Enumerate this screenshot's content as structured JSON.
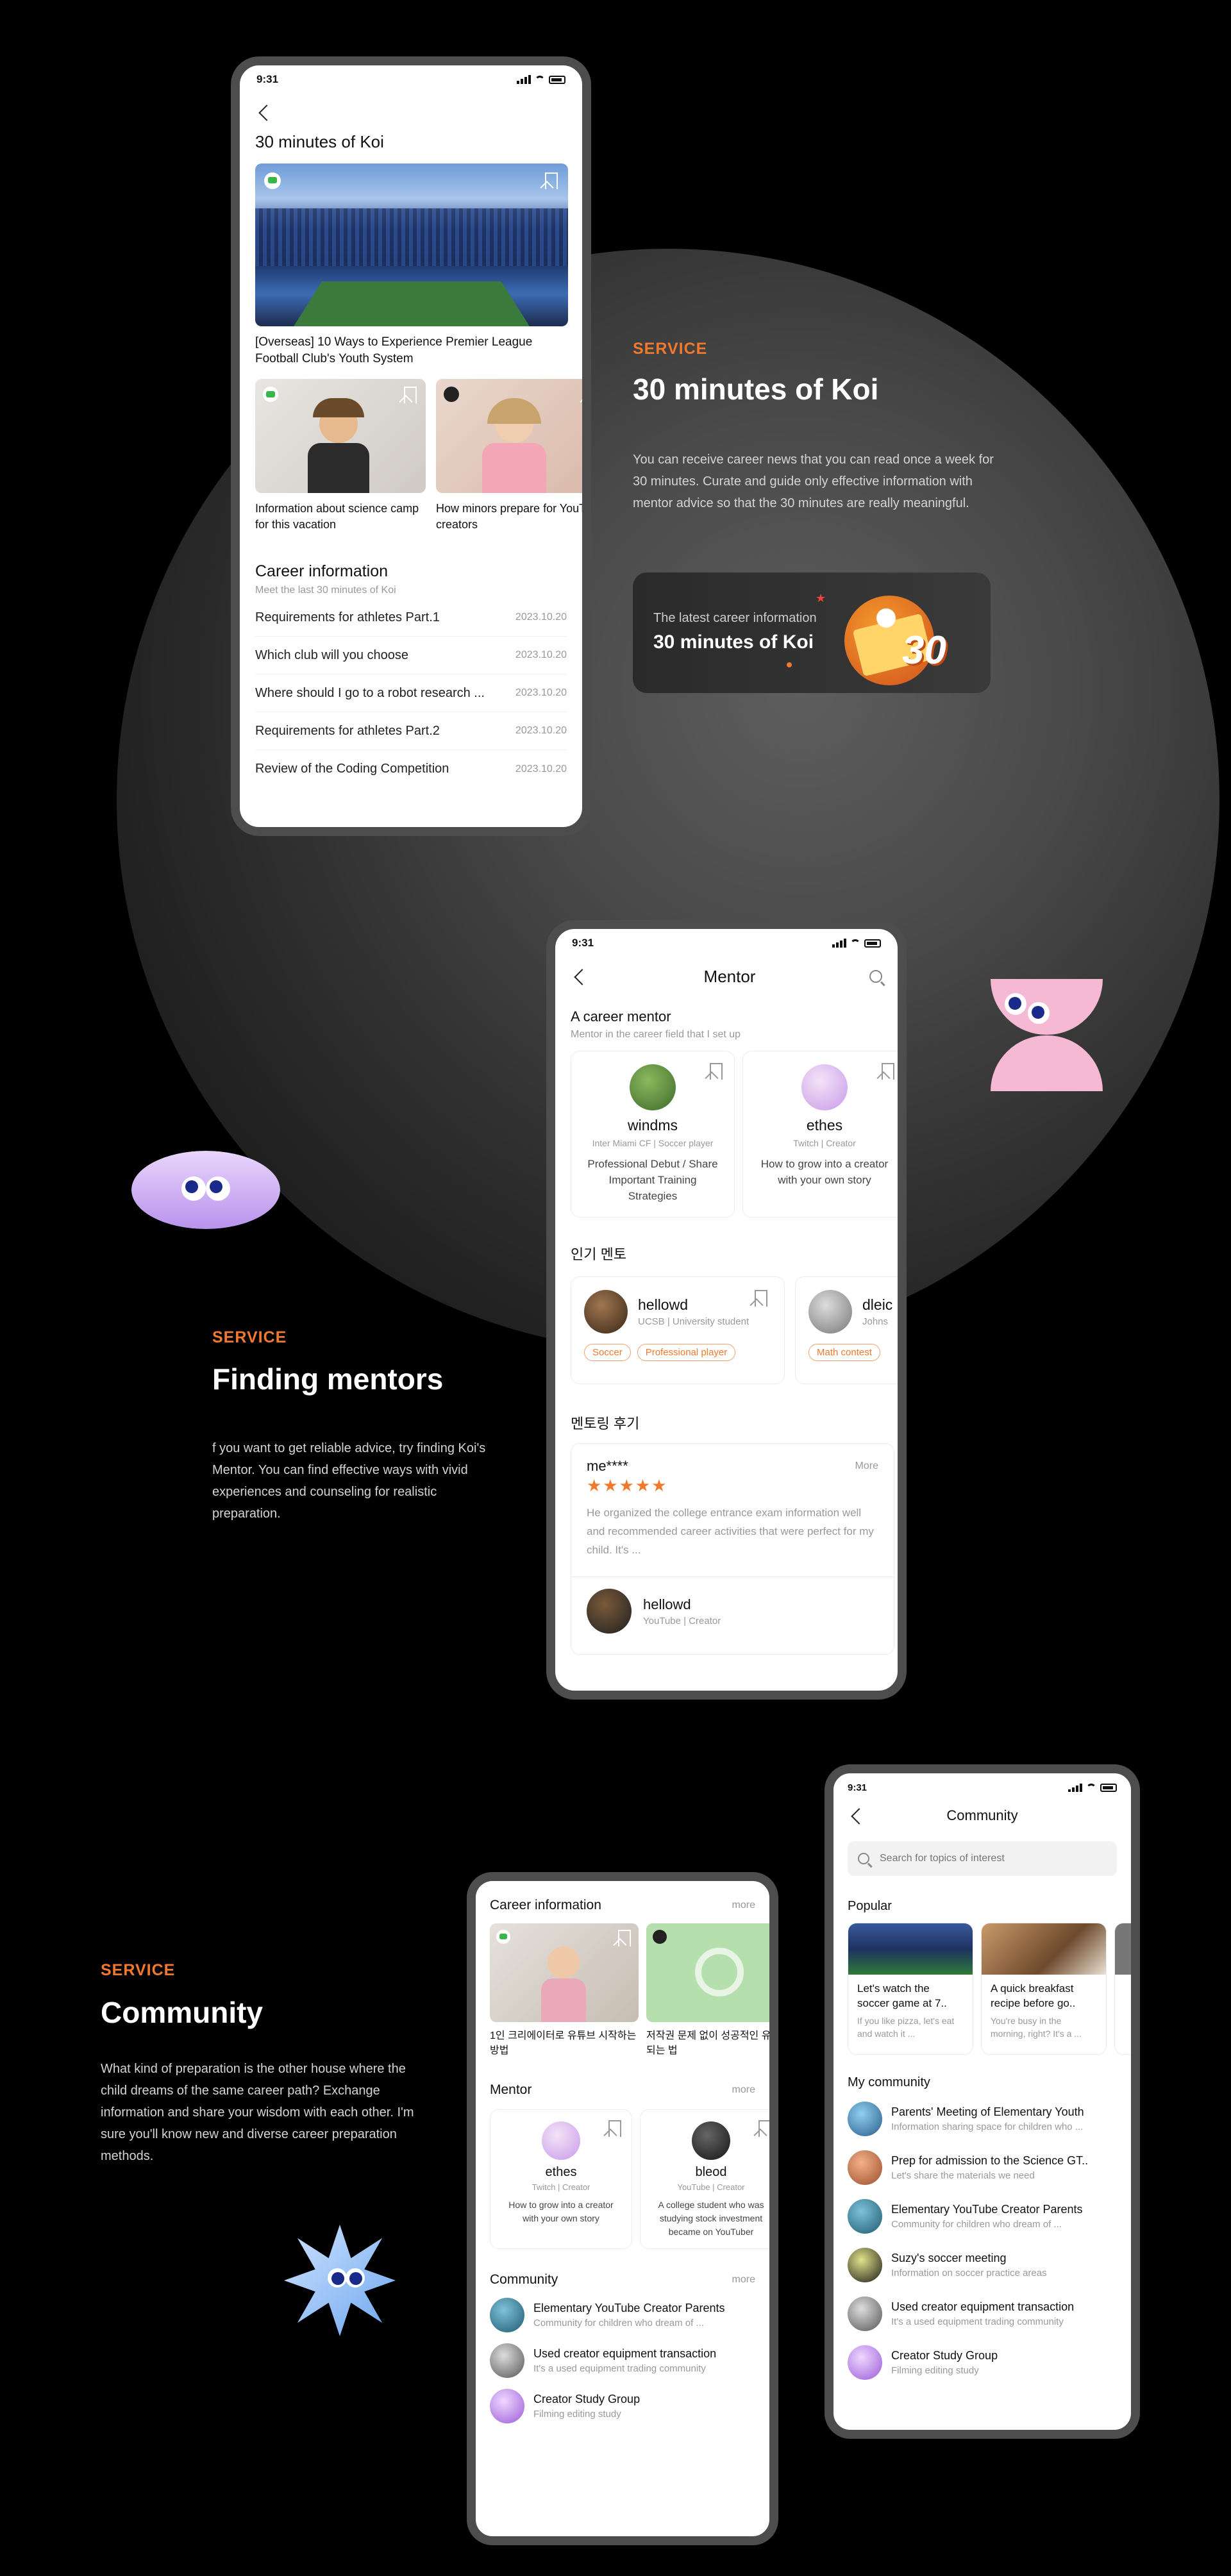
{
  "statusbar": {
    "time": "9:31"
  },
  "section1": {
    "label": "SERVICE",
    "title": "30 minutes of Koi",
    "description": "You can receive career news that you can read once a week for 30 minutes. Curate and guide only effective information with mentor advice so that the 30 minutes are really meaningful.",
    "banner": {
      "subtitle": "The latest career information",
      "title": "30 minutes of Koi",
      "badge": "30"
    }
  },
  "phone1": {
    "title": "30 minutes of Koi",
    "featured_caption": "[Overseas] 10 Ways to Experience Premier League Football Club's Youth System",
    "cards": [
      {
        "caption": "Information about science camp for this vacation"
      },
      {
        "caption": "How minors prepare for YouTube creators"
      }
    ],
    "career": {
      "heading": "Career information",
      "subheading": "Meet the last 30 minutes of Koi",
      "items": [
        {
          "title": "Requirements for athletes Part.1",
          "date": "2023.10.20"
        },
        {
          "title": "Which club will you choose",
          "date": "2023.10.20"
        },
        {
          "title": "Where should I go to a robot research ...",
          "date": "2023.10.20"
        },
        {
          "title": "Requirements for athletes Part.2",
          "date": "2023.10.20"
        },
        {
          "title": "Review of the Coding Competition",
          "date": "2023.10.20"
        }
      ]
    }
  },
  "section2": {
    "label": "SERVICE",
    "title": "Finding mentors",
    "description": "f you want to get reliable advice, try finding Koi's Mentor. You can find effective ways with vivid experiences and counseling for realistic preparation."
  },
  "phone2": {
    "title": "Mentor",
    "career_mentor": {
      "heading": "A career mentor",
      "subheading": "Mentor in the career field that I set up",
      "cards": [
        {
          "name": "windms",
          "role": "Inter Miami CF | Soccer player",
          "desc": "Professional Debut / Share Important Training Strategies"
        },
        {
          "name": "ethes",
          "role": "Twitch | Creator",
          "desc": "How to grow into a creator with your own story"
        }
      ]
    },
    "popular": {
      "heading": "인기 멘토",
      "cards": [
        {
          "name": "hellowd",
          "role": "UCSB | University student",
          "tags": [
            "Soccer",
            "Professional player"
          ]
        },
        {
          "name": "dleic",
          "role": "Johns",
          "tags": [
            "Math contest"
          ]
        }
      ]
    },
    "review": {
      "heading": "멘토링 후기",
      "reviewer": "me****",
      "more": "More",
      "stars": "★★★★★",
      "text": "He organized the college entrance exam information well and recommended career activities that were perfect for my child. It's ...",
      "mentor_name": "hellowd",
      "mentor_role": "YouTube | Creator"
    }
  },
  "section3": {
    "label": "SERVICE",
    "title": "Community",
    "description": "What kind of preparation is the other house where the child dreams of the same career path? Exchange information and share your wisdom with each other. I'm sure you'll know new and diverse career preparation methods."
  },
  "phone3": {
    "career": {
      "heading": "Career information",
      "more": "more",
      "cards": [
        {
          "caption": "1인 크리에이터로 유튜브 시작하는 방법"
        },
        {
          "caption": "저작권 문제 없이 성공적인 유튜버 되는 법"
        }
      ]
    },
    "mentor": {
      "heading": "Mentor",
      "more": "more",
      "cards": [
        {
          "name": "ethes",
          "role": "Twitch | Creator",
          "desc": "How to grow into a creator with your own story"
        },
        {
          "name": "bleod",
          "role": "YouTube | Creator",
          "desc": "A college student who was studying stock investment became on YouTuber"
        }
      ]
    },
    "community": {
      "heading": "Community",
      "more": "more",
      "items": [
        {
          "title": "Elementary YouTube Creator Parents",
          "sub": "Community for children who dream of ..."
        },
        {
          "title": "Used creator equipment transaction",
          "sub": "It's a used equipment trading community"
        },
        {
          "title": "Creator Study Group",
          "sub": "Filming editing study"
        }
      ]
    }
  },
  "phone4": {
    "title": "Community",
    "search_placeholder": "Search for topics of interest",
    "popular": {
      "heading": "Popular",
      "cards": [
        {
          "title": "Let's watch the soccer game at 7..",
          "sub": "If you like pizza, let's eat and watch it ..."
        },
        {
          "title": "A quick breakfast recipe before go..",
          "sub": "You're busy in the morning, right? It's a ..."
        }
      ]
    },
    "my_community": {
      "heading": "My community",
      "items": [
        {
          "title": "Parents' Meeting of Elementary Youth",
          "sub": "Information sharing space for children who ..."
        },
        {
          "title": "Prep for admission to the Science GT..",
          "sub": "Let's share the materials we need"
        },
        {
          "title": "Elementary YouTube Creator Parents",
          "sub": "Community for children who dream of ..."
        },
        {
          "title": "Suzy's soccer meeting",
          "sub": "Information on soccer practice areas"
        },
        {
          "title": "Used creator equipment transaction",
          "sub": "It's a used equipment trading community"
        },
        {
          "title": "Creator Study Group",
          "sub": "Filming editing study"
        }
      ]
    }
  },
  "colors": {
    "accent": "#f0792e",
    "background": "#000000",
    "phone_frame": "#4d4d4d"
  }
}
